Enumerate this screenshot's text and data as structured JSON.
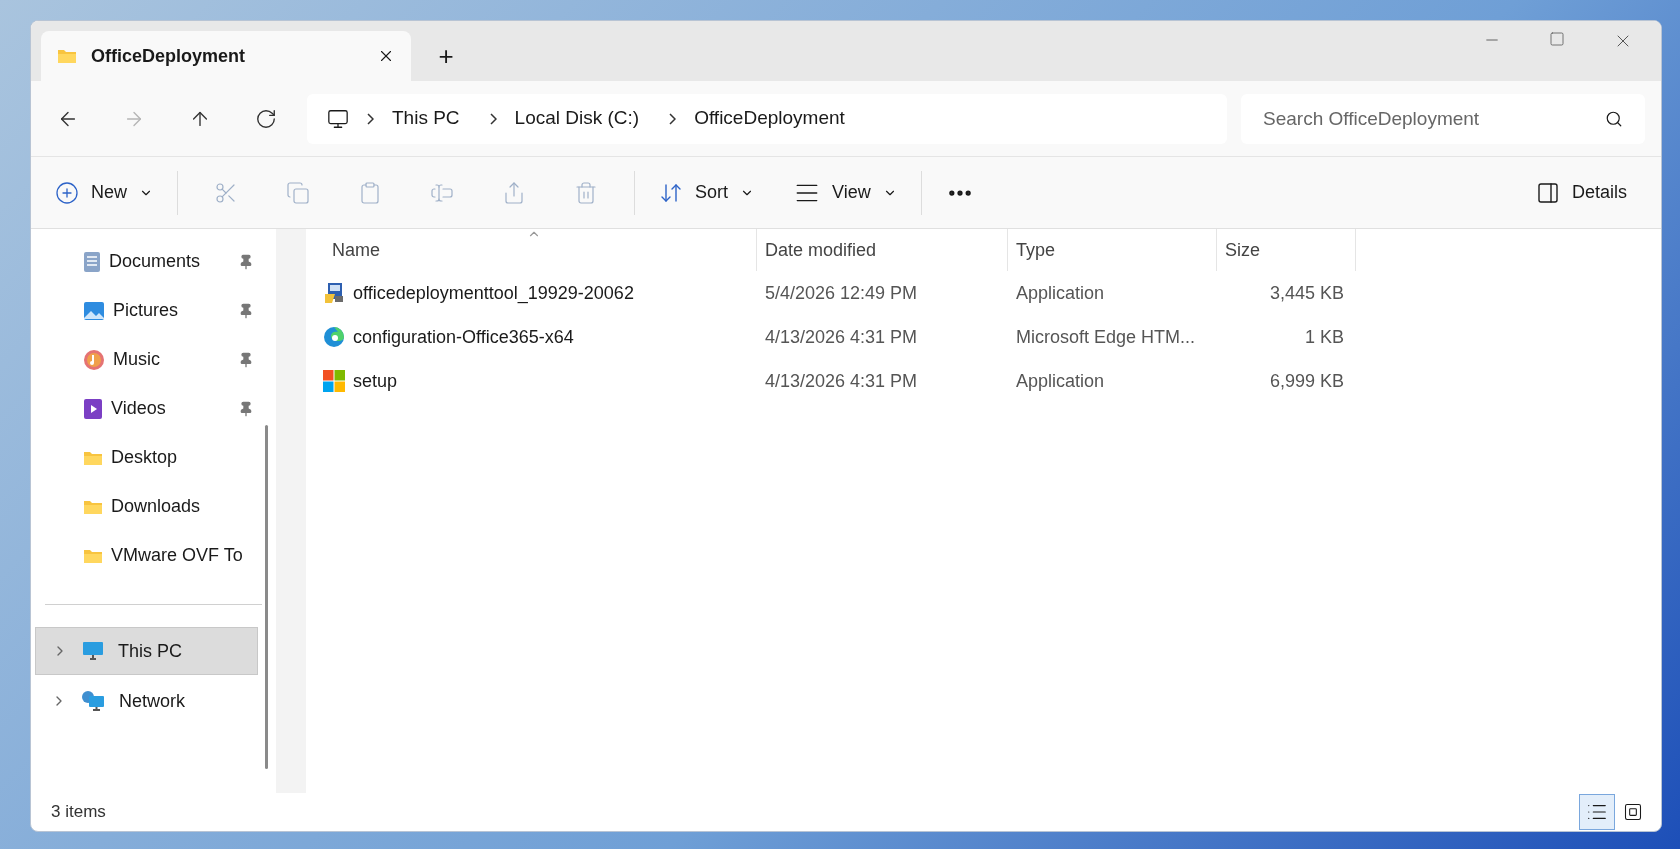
{
  "tab": {
    "title": "OfficeDeployment",
    "new_tab": "+"
  },
  "nav": [
    {
      "kind": "back",
      "disabled": false
    },
    {
      "kind": "forward",
      "disabled": true
    },
    {
      "kind": "up",
      "disabled": false
    },
    {
      "kind": "refresh",
      "disabled": false
    }
  ],
  "breadcrumb": [
    "This PC",
    "Local Disk (C:)",
    "OfficeDeployment"
  ],
  "search": {
    "placeholder": "Search OfficeDeployment"
  },
  "toolbar": {
    "new": "New",
    "actions": [
      {
        "kind": "cut",
        "disabled": true
      },
      {
        "kind": "copy",
        "disabled": true
      },
      {
        "kind": "paste",
        "disabled": true
      },
      {
        "kind": "rename",
        "disabled": true
      },
      {
        "kind": "share",
        "disabled": true
      },
      {
        "kind": "delete",
        "disabled": true
      }
    ],
    "sort": "Sort",
    "view": "View",
    "details": "Details"
  },
  "sidebar": {
    "pinned": [
      {
        "kind": "documents",
        "label": "Documents",
        "pinned": true
      },
      {
        "kind": "pictures",
        "label": "Pictures",
        "pinned": true
      },
      {
        "kind": "music",
        "label": "Music",
        "pinned": true
      },
      {
        "kind": "videos",
        "label": "Videos",
        "pinned": true
      },
      {
        "kind": "folder",
        "label": "Desktop",
        "pinned": false
      },
      {
        "kind": "folder",
        "label": "Downloads",
        "pinned": false
      },
      {
        "kind": "folder",
        "label": "VMware OVF To",
        "pinned": false
      }
    ],
    "tree": [
      {
        "kind": "pc",
        "label": "This PC",
        "selected": true,
        "expanded": false
      },
      {
        "kind": "network",
        "label": "Network",
        "selected": false,
        "expanded": false
      }
    ]
  },
  "table": {
    "columns": [
      {
        "label": "Name",
        "sorted": true
      },
      {
        "label": "Date modified",
        "sorted": false
      },
      {
        "label": "Type",
        "sorted": false
      },
      {
        "label": "Size",
        "sorted": false
      }
    ],
    "rows": [
      {
        "kind": "installer",
        "name": "officedeploymenttool_19929-20062",
        "date": "5/4/2026 12:49 PM",
        "type": "Application",
        "size": "3,445 KB"
      },
      {
        "kind": "edge",
        "name": "configuration-Office365-x64",
        "date": "4/13/2026 4:31 PM",
        "type": "Microsoft Edge HTM...",
        "size": "1 KB"
      },
      {
        "kind": "windows",
        "name": "setup",
        "date": "4/13/2026 4:31 PM",
        "type": "Application",
        "size": "6,999 KB"
      }
    ]
  },
  "status_bar": {
    "count": "3 items",
    "views": [
      {
        "kind": "details",
        "selected": true
      },
      {
        "kind": "tiles",
        "selected": false
      }
    ]
  }
}
